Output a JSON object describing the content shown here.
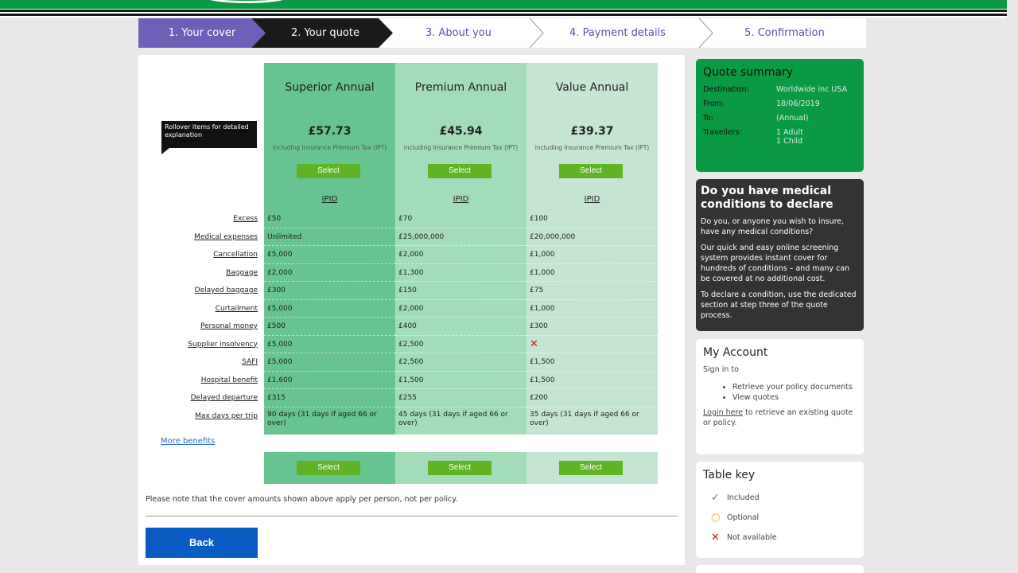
{
  "steps": [
    {
      "label": "1. Your cover"
    },
    {
      "label": "2. Your quote"
    },
    {
      "label": "3. About you"
    },
    {
      "label": "4. Payment details"
    },
    {
      "label": "5. Confirmation"
    }
  ],
  "tooltip": "Rollover items for detailed explanation",
  "row_labels": [
    "Excess",
    "Medical expenses",
    "Cancellation",
    "Baggage",
    "Delayed baggage",
    "Curtailment",
    "Personal money",
    "Supplier insolvency",
    "SAFI",
    "Hospital benefit",
    "Delayed departure",
    "Max days per trip"
  ],
  "products": [
    {
      "name": "Superior Annual",
      "price": "£57.73",
      "ipt": "including Insurance Premium Tax (IPT)",
      "select": "Select",
      "ipid": "IPID",
      "values": [
        "£50",
        "Unlimited",
        "£5,000",
        "£2,000",
        "£300",
        "£5,000",
        "£500",
        "£5,000",
        "£5,000",
        "£1,600",
        "£315",
        "90 days (31 days if aged 66 or over)"
      ]
    },
    {
      "name": "Premium Annual",
      "price": "£45.94",
      "ipt": "including Insurance Premium Tax (IPT)",
      "select": "Select",
      "ipid": "IPID",
      "values": [
        "£70",
        "£25,000,000",
        "£2,000",
        "£1,300",
        "£150",
        "£2,000",
        "£400",
        "£2,500",
        "£2,500",
        "£1,500",
        "£255",
        "45 days (31 days if aged 66 or over)"
      ]
    },
    {
      "name": "Value Annual",
      "price": "£39.37",
      "ipt": "including Insurance Premium Tax (IPT)",
      "select": "Select",
      "ipid": "IPID",
      "values": [
        "£100",
        "£20,000,000",
        "£1,000",
        "£1,000",
        "£75",
        "£1,000",
        "£300",
        "✕",
        "£1,500",
        "£1,500",
        "£200",
        "35 days (31 days if aged 66 or over)"
      ]
    }
  ],
  "more_benefits": "More benefits",
  "note": "Please note that the cover amounts shown above apply per person, not per policy.",
  "back": "Back",
  "quote_summary": {
    "title": "Quote summary",
    "destination_label": "Destination:",
    "destination": "Worldwide inc USA",
    "from_label": "From:",
    "from": "18/06/2019",
    "to_label": "To:",
    "to": "(Annual)",
    "travellers_label": "Travellers:",
    "travellers_1": "1 Adult",
    "travellers_2": "1 Child"
  },
  "medical": {
    "title": "Do you have medical conditions to declare",
    "p1": "Do you, or anyone you wish to insure, have any medical conditions?",
    "p2": "Our quick and easy online screening system provides instant cover for hundreds of conditions – and many can be covered at no additional cost.",
    "p3": "To declare a condition, use the dedicated section at step three of the quote process."
  },
  "account": {
    "title": "My Account",
    "sign_in": "Sign in to",
    "items": [
      "Retrieve your policy documents",
      "View quotes"
    ],
    "login_link": "Login here",
    "login_rest": " to retrieve an existing quote or policy."
  },
  "table_key": {
    "title": "Table key",
    "included": "Included",
    "optional": "Optional",
    "not_available": "Not available"
  },
  "colors": {
    "brand_green": "#0a9a43",
    "step_active": "#6b5fb8",
    "select_button": "#5fb324",
    "back_button": "#0b5cc2"
  }
}
